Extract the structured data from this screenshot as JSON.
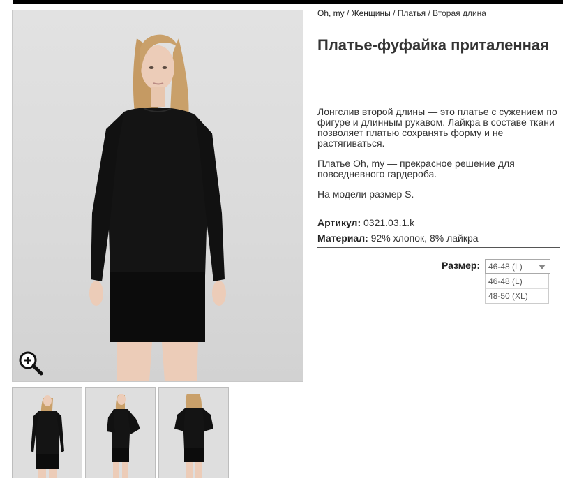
{
  "breadcrumb": [
    {
      "label": "Oh, my"
    },
    {
      "label": "Женщины"
    },
    {
      "label": "Платья"
    },
    {
      "label": "Вторая длина"
    }
  ],
  "breadcrumb_separator": "/",
  "product": {
    "title": "Платье-фуфайка приталенная",
    "description": [
      "Лонгслив второй длины — это платье с сужением по фигуре и длинным рукавом. Лайкра в составе ткани позволяет платью сохранять форму и не растягиваться.",
      "Платье Oh, my — прекрасное решение для повседневного гардероба.",
      "На модели размер S."
    ],
    "sku_label": "Артикул:",
    "sku_value": "0321.03.1.k",
    "material_label": "Материал:",
    "material_value": "92% хлопок, 8% лайкра"
  },
  "size": {
    "label": "Размер:",
    "selected": "46-48 (L)",
    "options": [
      "46-48 (L)",
      "48-50 (XL)"
    ]
  },
  "gallery": {
    "main_icon": "zoom-in-icon",
    "thumbnails": [
      "front",
      "side",
      "back"
    ]
  },
  "colors": {
    "photo_background": "#dcdcdc",
    "dress": "#111111",
    "hair": "#c9a06a",
    "skin": "#eac8b2"
  }
}
